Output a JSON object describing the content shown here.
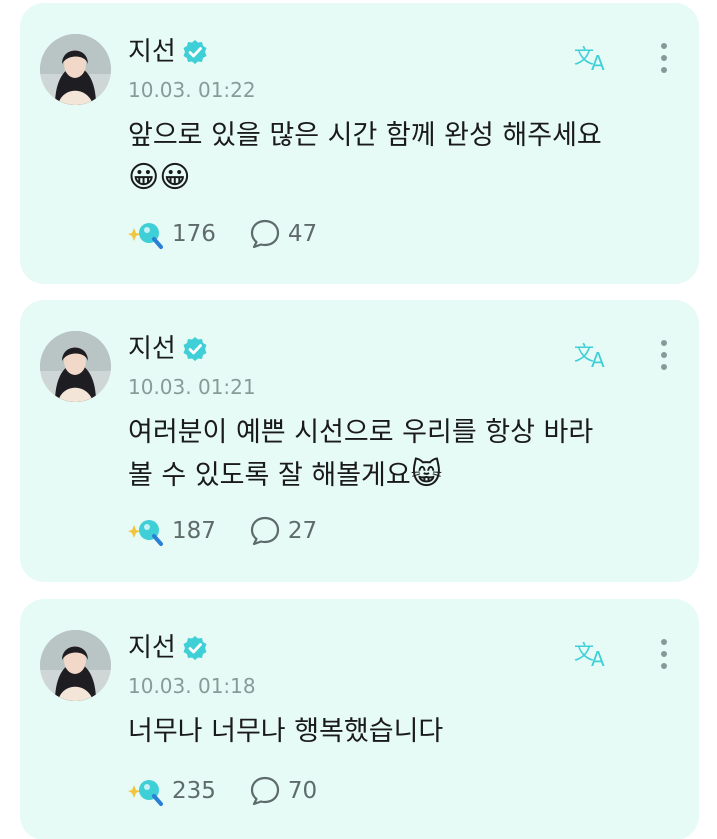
{
  "colors": {
    "card_background": "#e6fbf6",
    "accent": "#3fcfd6",
    "muted_text": "#8a9a98"
  },
  "posts": [
    {
      "author": "지선",
      "time": "10.03. 01:22",
      "text": "앞으로 있을 많은 시간 함께 완성 해주세요",
      "emoji": "😀😀",
      "likes": "176",
      "comments": "47"
    },
    {
      "author": "지선",
      "time": "10.03. 01:21",
      "text": "여러분이 예쁜 시선으로 우리를 항상 바라\n볼 수 있도록 잘 해볼게요",
      "emoji": "😸",
      "likes": "187",
      "comments": "27"
    },
    {
      "author": "지선",
      "time": "10.03. 01:18",
      "text": "너무나 너무나 행복했습니다",
      "emoji": "",
      "likes": "235",
      "comments": "70"
    }
  ],
  "icons": {
    "verified": "verified-badge-icon",
    "translate": "translate-icon",
    "more": "more-vertical-icon",
    "like": "like-sparkle-icon",
    "comment": "comment-bubble-icon"
  }
}
